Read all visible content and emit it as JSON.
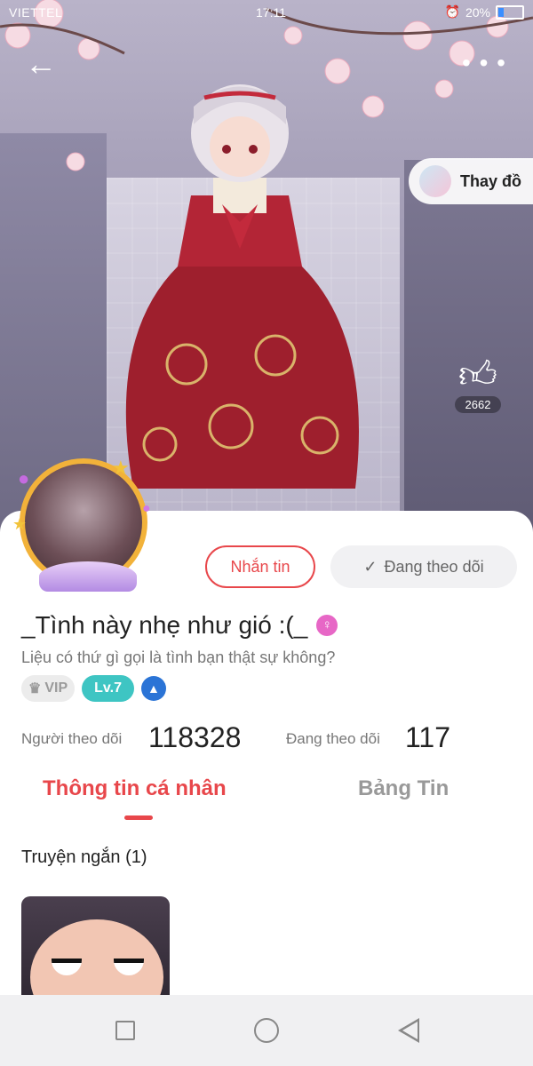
{
  "status_bar": {
    "carrier": "VIETTEL",
    "time": "17:11",
    "battery": "20%"
  },
  "hero": {
    "change_outfit_label": "Thay đồ",
    "like_count": "2662"
  },
  "profile": {
    "message_button": "Nhắn tin",
    "following_button": "Đang theo dõi",
    "name": "_Tình này nhẹ như gió :(_",
    "bio": "Liệu có thứ gì gọi là tình bạn thật sự không?",
    "vip_label": "VIP",
    "level_label": "Lv.7",
    "followers_label": "Người theo dõi",
    "followers_count": "118328",
    "following_label": "Đang theo dõi",
    "following_count": "117"
  },
  "tabs": [
    {
      "label": "Thông tin cá nhân",
      "active": true
    },
    {
      "label": "Bảng Tin",
      "active": false
    }
  ],
  "section": {
    "title": "Truyện ngắn (1)"
  },
  "colors": {
    "accent": "#e8474b",
    "level": "#3ec5c3",
    "avatar_ring": "#f2b23a"
  },
  "icons": [
    "back-arrow-icon",
    "more-dots-icon",
    "thumbs-up-icon",
    "check-icon",
    "female-icon",
    "crown-icon",
    "shield-badge-icon",
    "wifi-icon",
    "alarm-icon",
    "battery-icon",
    "nav-square-icon",
    "nav-home-icon",
    "nav-back-icon"
  ]
}
